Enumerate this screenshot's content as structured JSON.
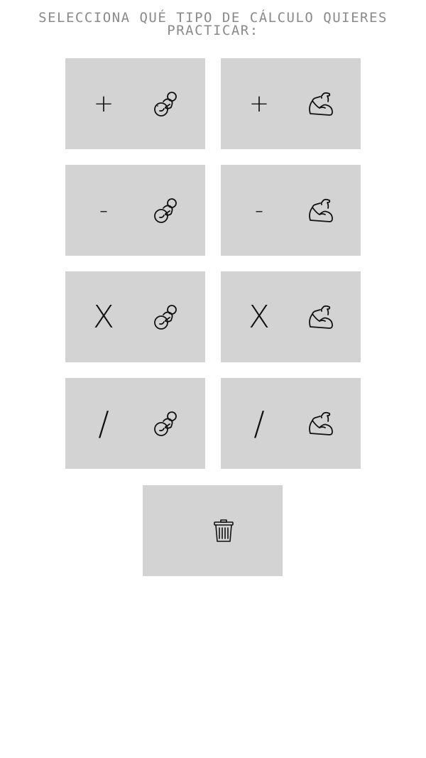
{
  "heading": {
    "line1": "SELECCIONA QUÉ TIPO DE CÁLCULO QUIERES",
    "line2": "PRACTICAR:"
  },
  "tiles": [
    {
      "operator": "+",
      "level_icon": "pacifier-icon"
    },
    {
      "operator": "+",
      "level_icon": "flexed-biceps-icon"
    },
    {
      "operator": "-",
      "level_icon": "pacifier-icon"
    },
    {
      "operator": "-",
      "level_icon": "flexed-biceps-icon"
    },
    {
      "operator": "X",
      "level_icon": "pacifier-icon"
    },
    {
      "operator": "X",
      "level_icon": "flexed-biceps-icon"
    },
    {
      "operator": "/",
      "level_icon": "pacifier-icon"
    },
    {
      "operator": "/",
      "level_icon": "flexed-biceps-icon"
    }
  ],
  "clear_button": {
    "icon": "trash-icon"
  },
  "colors": {
    "tile_background": "#d3d3d3",
    "heading_text": "#8a8a8a",
    "icon_stroke": "#111111"
  }
}
